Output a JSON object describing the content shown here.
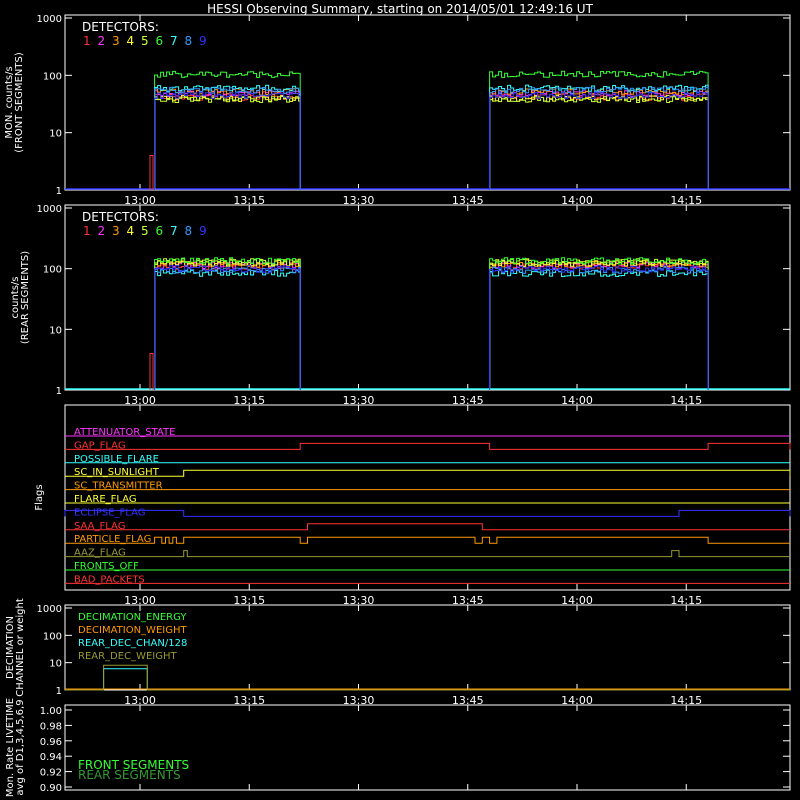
{
  "title": "HESSI Observing Summary, starting on 2014/05/01 12:49:16 UT",
  "time_ticks": [
    "13:00",
    "13:15",
    "13:30",
    "13:45",
    "14:00",
    "14:15"
  ],
  "detector_colors": [
    "#ff3333",
    "#ff33ff",
    "#ff9a00",
    "#ffff33",
    "#ccff33",
    "#33ff33",
    "#33ffff",
    "#3399ff",
    "#3333ff"
  ],
  "chart_data": [
    {
      "type": "line",
      "panel": "front",
      "ylabel": [
        "MON. counts/s",
        "(FRONT SEGMENTS)"
      ],
      "y_scale": "log",
      "ylim": [
        1,
        1000
      ],
      "y_ticks": [
        "1",
        "10",
        "100",
        "1000"
      ],
      "x_ticks": [
        "13:00",
        "13:15",
        "13:30",
        "13:45",
        "14:00",
        "14:15"
      ],
      "legend": {
        "title": "DETECTORS:",
        "labels": [
          "1",
          "2",
          "3",
          "4",
          "5",
          "6",
          "7",
          "8",
          "9"
        ]
      },
      "segments": [
        {
          "start": "13:02",
          "end": "13:22"
        },
        {
          "start": "13:48",
          "end": "14:18"
        }
      ],
      "series": [
        {
          "name": "1",
          "color": "#ff3333",
          "level": 42
        },
        {
          "name": "2",
          "color": "#ff33ff",
          "level": 48
        },
        {
          "name": "3",
          "color": "#ff9a00",
          "level": 52
        },
        {
          "name": "4",
          "color": "#ffff33",
          "level": 40
        },
        {
          "name": "5",
          "color": "#ccff33",
          "level": 38
        },
        {
          "name": "6",
          "color": "#33ff33",
          "level": 105
        },
        {
          "name": "7",
          "color": "#33ffff",
          "level": 60
        },
        {
          "name": "8",
          "color": "#3399ff",
          "level": 55
        },
        {
          "name": "9",
          "color": "#3333ff",
          "level": 45
        }
      ]
    },
    {
      "type": "line",
      "panel": "rear",
      "ylabel": [
        "counts/s",
        "(REAR SEGMENTS)"
      ],
      "y_scale": "log",
      "ylim": [
        1,
        1000
      ],
      "y_ticks": [
        "1",
        "10",
        "100",
        "1000"
      ],
      "x_ticks": [
        "13:00",
        "13:15",
        "13:30",
        "13:45",
        "14:00",
        "14:15"
      ],
      "legend": {
        "title": "DETECTORS:",
        "labels": [
          "1",
          "2",
          "3",
          "4",
          "5",
          "6",
          "7",
          "8",
          "9"
        ]
      },
      "segments": [
        {
          "start": "13:02",
          "end": "13:22"
        },
        {
          "start": "13:48",
          "end": "14:18"
        }
      ],
      "series": [
        {
          "name": "1",
          "color": "#ff3333",
          "level": 110
        },
        {
          "name": "2",
          "color": "#ff33ff",
          "level": 115
        },
        {
          "name": "3",
          "color": "#ff9a00",
          "level": 120
        },
        {
          "name": "4",
          "color": "#ffff33",
          "level": 125
        },
        {
          "name": "5",
          "color": "#ccff33",
          "level": 130
        },
        {
          "name": "6",
          "color": "#33ff33",
          "level": 135
        },
        {
          "name": "7",
          "color": "#33ffff",
          "level": 85
        },
        {
          "name": "8",
          "color": "#3399ff",
          "level": 95
        },
        {
          "name": "9",
          "color": "#3333ff",
          "level": 100
        }
      ]
    },
    {
      "type": "line",
      "panel": "flags",
      "ylabel": [
        "Flags"
      ],
      "x_ticks": [
        "13:00",
        "13:15",
        "13:30",
        "13:45",
        "14:00",
        "14:15"
      ],
      "flags": [
        {
          "name": "ATTENUATOR_STATE",
          "color": "#ff33ff",
          "high": []
        },
        {
          "name": "GAP_FLAG",
          "color": "#ff3333",
          "high": [
            [
              "13:22",
              "13:48"
            ],
            [
              "14:18",
              "14:30"
            ]
          ]
        },
        {
          "name": "POSSIBLE_FLARE",
          "color": "#33ffff",
          "high": []
        },
        {
          "name": "SC_IN_SUNLIGHT",
          "color": "#ffff33",
          "high": [
            [
              "13:06",
              "14:30"
            ]
          ]
        },
        {
          "name": "SC_TRANSMITTER",
          "color": "#ff9a00",
          "high": []
        },
        {
          "name": "FLARE_FLAG",
          "color": "#ffff33",
          "high": []
        },
        {
          "name": "ECLIPSE_FLAG",
          "color": "#3333ff",
          "high": [
            [
              "12:49",
              "13:06"
            ],
            [
              "14:14",
              "14:30"
            ]
          ]
        },
        {
          "name": "SAA_FLAG",
          "color": "#ff3333",
          "high": [
            [
              "13:23",
              "13:47"
            ]
          ]
        },
        {
          "name": "PARTICLE_FLAG",
          "color": "#ff9a00",
          "high": [
            [
              "13:02",
              "13:03"
            ],
            [
              "13:03.5",
              "13:04"
            ],
            [
              "13:04.5",
              "13:05"
            ],
            [
              "13:06",
              "13:22"
            ],
            [
              "13:23",
              "13:46"
            ],
            [
              "13:47",
              "13:48"
            ],
            [
              "13:49",
              "14:18"
            ]
          ]
        },
        {
          "name": "AAZ_FLAG",
          "color": "#999933",
          "high": [
            [
              "13:06",
              "13:06.5"
            ],
            [
              "14:13",
              "14:14"
            ]
          ]
        },
        {
          "name": "FRONTS_OFF",
          "color": "#33ff33",
          "high": []
        },
        {
          "name": "BAD_PACKETS",
          "color": "#ff3333",
          "high": []
        }
      ]
    },
    {
      "type": "line",
      "panel": "decimation",
      "ylabel": [
        "DECIMATION",
        "CHANNEL or weight"
      ],
      "y_scale": "log",
      "ylim": [
        1,
        1000
      ],
      "y_ticks": [
        "1",
        "10",
        "100",
        "1000"
      ],
      "x_ticks": [
        "13:00",
        "13:15",
        "13:30",
        "13:45",
        "14:00",
        "14:15"
      ],
      "legend_labels": [
        "DECIMATION_ENERGY",
        "DECIMATION_WEIGHT",
        "REAR_DEC_CHAN/128",
        "REAR_DEC_WEIGHT"
      ],
      "series": [
        {
          "name": "DECIMATION_ENERGY",
          "color": "#33ff33",
          "level": 1
        },
        {
          "name": "DECIMATION_WEIGHT",
          "color": "#ff9a00",
          "level": 1
        },
        {
          "name": "REAR_DEC_CHAN/128",
          "color": "#33ffff",
          "level": 6,
          "window": [
            "12:55",
            "13:01"
          ]
        },
        {
          "name": "REAR_DEC_WEIGHT",
          "color": "#999933",
          "level": 8,
          "window": [
            "12:55",
            "13:01"
          ]
        }
      ]
    },
    {
      "type": "line",
      "panel": "livetime",
      "ylabel": [
        "Mon. Rate LIVETIME",
        "avg of D1,3,4,5,6,9"
      ],
      "ylim": [
        0.9,
        1.0
      ],
      "y_ticks": [
        "0.90",
        "0.92",
        "0.94",
        "0.96",
        "0.98",
        "1.00"
      ],
      "legend_labels": [
        "FRONT SEGMENTS",
        "REAR SEGMENTS"
      ],
      "legend_colors": [
        "#33ff33",
        "#339933"
      ]
    }
  ]
}
